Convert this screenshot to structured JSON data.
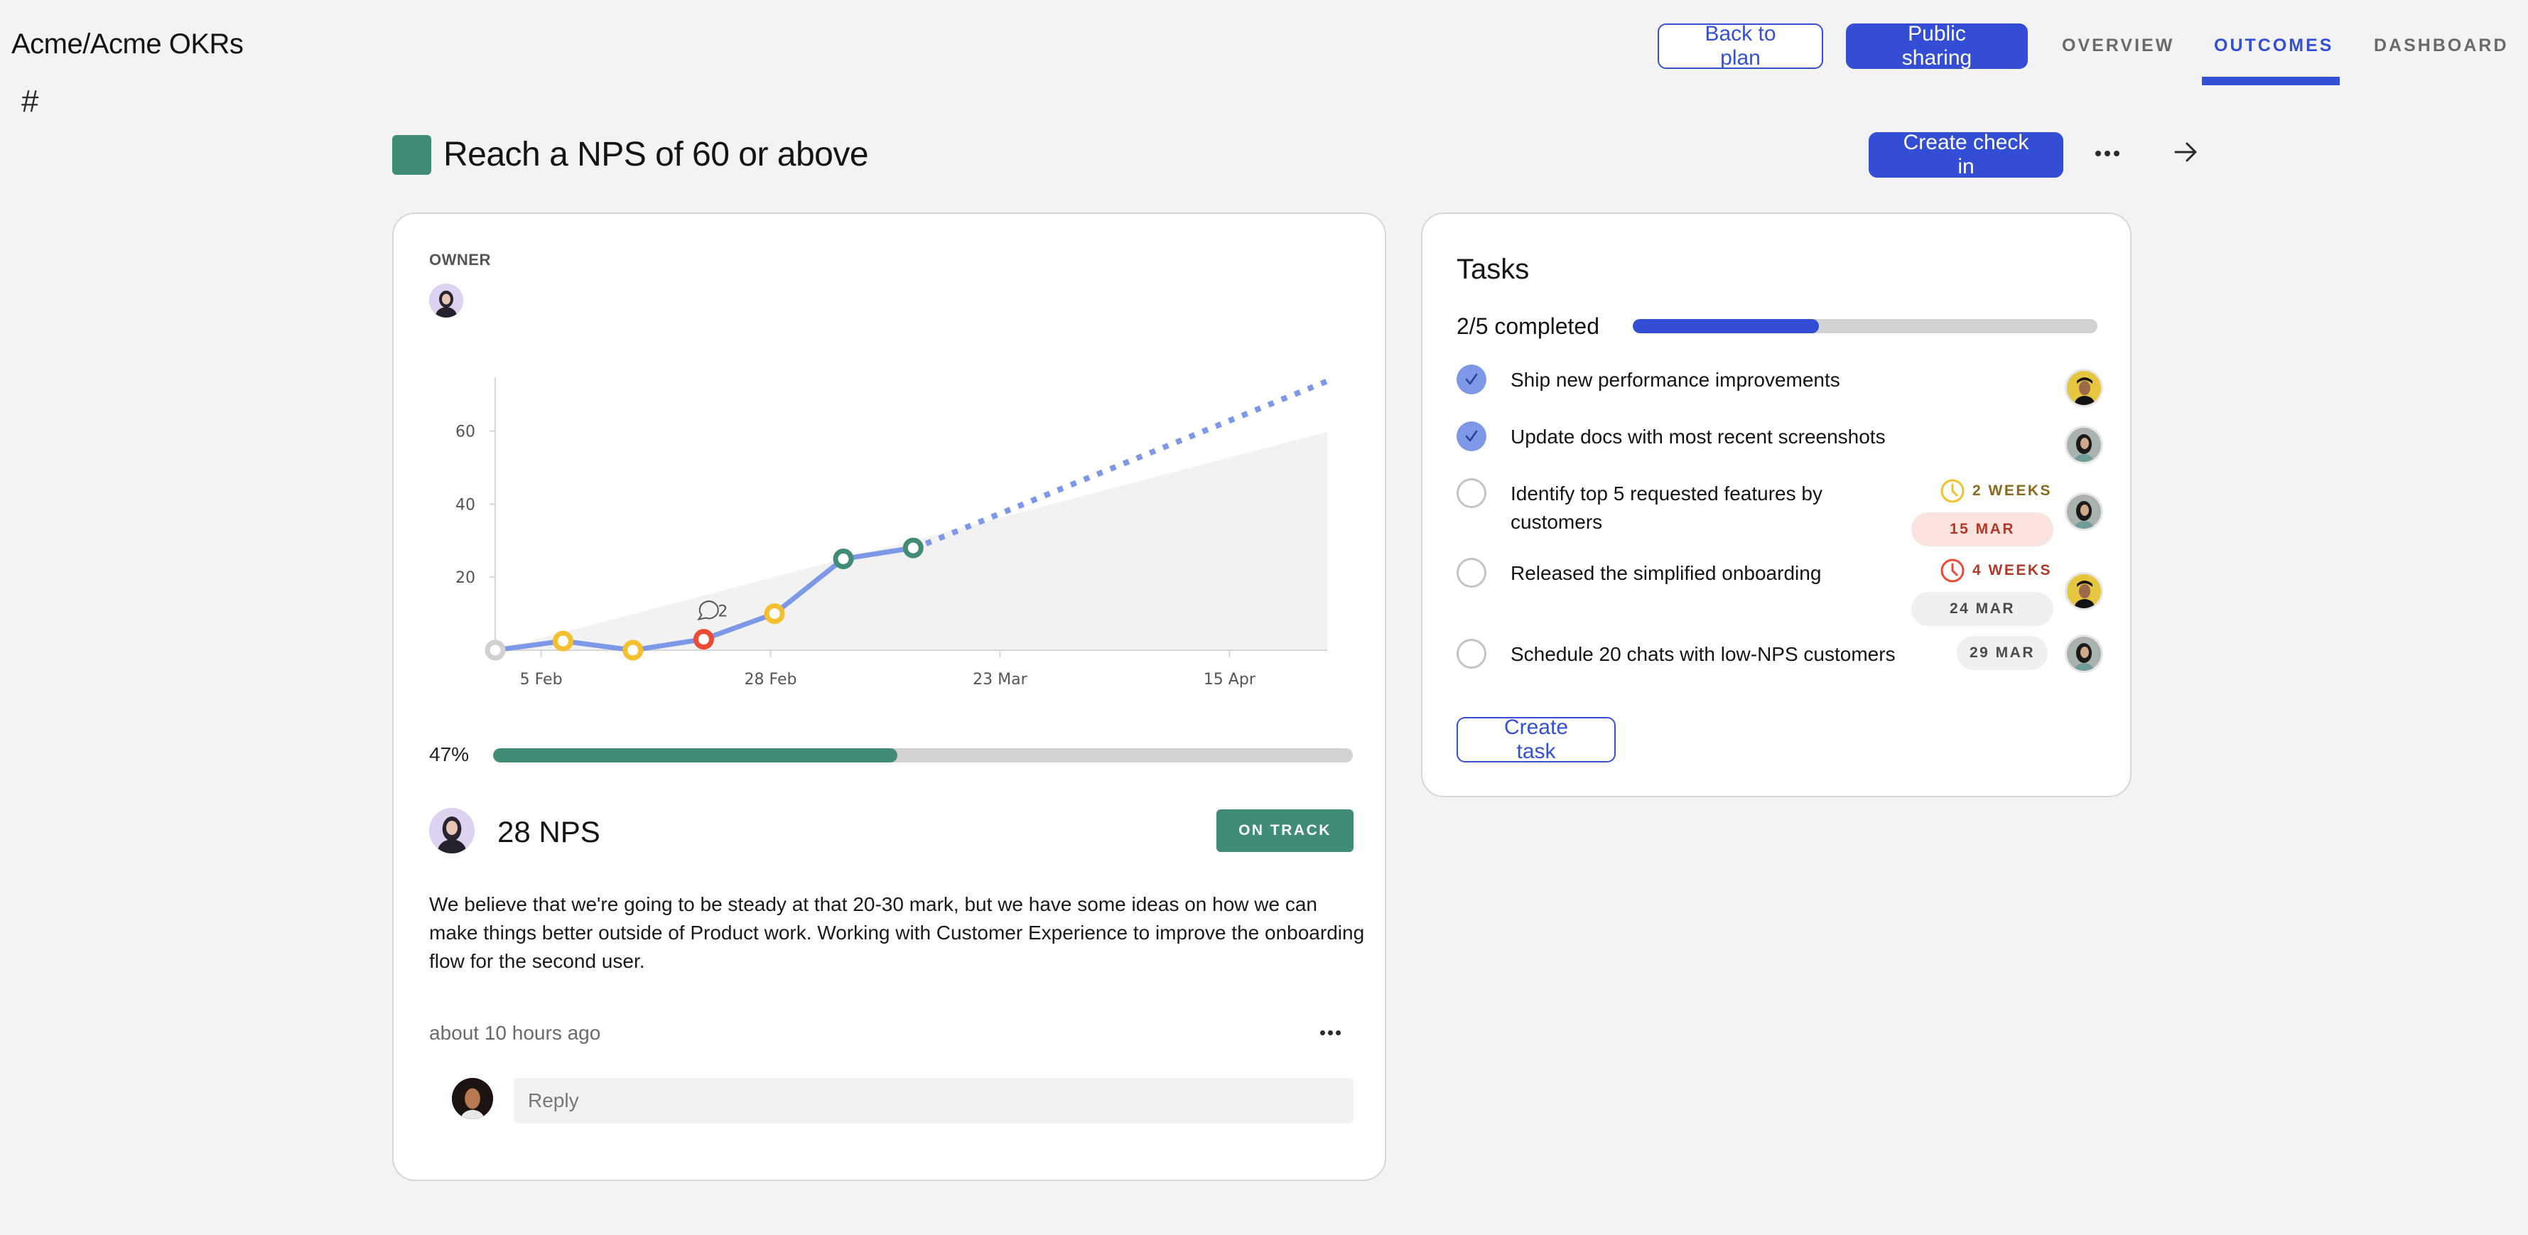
{
  "breadcrumb": {
    "workspace": "Acme",
    "separator": "/",
    "project": "Acme OKRs"
  },
  "sidebar": {
    "hash_icon": "#"
  },
  "header": {
    "back_button": "Back to plan",
    "share_button": "Public sharing",
    "tabs": [
      {
        "label": "OVERVIEW",
        "active": false
      },
      {
        "label": "OUTCOMES",
        "active": true
      },
      {
        "label": "DASHBOARD",
        "active": false
      }
    ]
  },
  "colors": {
    "accent": "#334ed4",
    "on_track": "#418c76",
    "at_risk": "#f5c02f",
    "off_track": "#ec4a34",
    "neutral": "#d0d0d0",
    "line": "#7d98e6",
    "target_area": "#f2f2f2"
  },
  "objective": {
    "title": "Reach a NPS of 60 or above",
    "color": "#418c76",
    "create_checkin_button": "Create check in",
    "more_icon": "more-horizontal-icon",
    "next_icon": "arrow-right-icon"
  },
  "outcome_card": {
    "owner_label": "OWNER",
    "progress_label": "47%",
    "progress_fraction": 0.47,
    "current_value": "28 NPS",
    "status": "ON TRACK",
    "comment": "We believe that we're going to be steady at that 20-30 mark, but we have some ideas on how we can make things better outside of Product work. Working with Customer Experience to improve the onboarding flow for the second user.",
    "timestamp": "about 10 hours ago",
    "reply_placeholder": "Reply"
  },
  "chart_data": {
    "type": "line",
    "title": "",
    "xlabel": "",
    "ylabel": "",
    "x_tick_labels": [
      "5 Feb",
      "28 Feb",
      "23 Mar",
      "15 Apr"
    ],
    "x_tick_days": [
      5,
      28,
      51,
      74
    ],
    "y_ticks": [
      20,
      40,
      60
    ],
    "ylim": [
      0,
      75
    ],
    "xlim_days": [
      0.4,
      37.1
    ],
    "grid": false,
    "series": [
      {
        "name": "Check-ins",
        "style": "solid",
        "points": [
          {
            "day": 0.4,
            "value": 0,
            "status": "neutral"
          },
          {
            "day": 7.2,
            "value": 2.5,
            "status": "at_risk"
          },
          {
            "day": 14.2,
            "value": 0,
            "status": "at_risk"
          },
          {
            "day": 21.3,
            "value": 3,
            "status": "off_track",
            "comments": 2
          },
          {
            "day": 28.4,
            "value": 10,
            "status": "at_risk"
          },
          {
            "day": 35.3,
            "value": 25,
            "status": "on_track"
          },
          {
            "day": 42.3,
            "value": 28,
            "status": "on_track"
          }
        ]
      },
      {
        "name": "Forecast",
        "style": "dotted",
        "points": [
          {
            "day": 42.3,
            "value": 28
          },
          {
            "day": 84.1,
            "value": 74
          }
        ]
      },
      {
        "name": "Target",
        "style": "area",
        "points": [
          {
            "day": 0.4,
            "value": 0
          },
          {
            "day": 35.3,
            "value": 25
          },
          {
            "day": 84.1,
            "value": 60
          }
        ]
      }
    ],
    "annotations": [
      {
        "day": 21.3,
        "label": "2",
        "icon": "comment-icon"
      }
    ]
  },
  "tasks": {
    "title": "Tasks",
    "completed_label": "2/5 completed",
    "completed_fraction": 0.4,
    "items": [
      {
        "label": "Ship new performance improvements",
        "done": true,
        "assignee": "yellow-cap"
      },
      {
        "label": "Update docs with most recent screenshots",
        "done": true,
        "assignee": "hijab"
      },
      {
        "label": "Identify top 5 requested features by customers",
        "done": false,
        "remaining": "2 WEEKS",
        "remaining_color": "#f5c02f",
        "remaining_text_color": "#8a6a1a",
        "due": "15 MAR",
        "overdue": true,
        "assignee": "hijab"
      },
      {
        "label": "Released the simplified onboarding",
        "done": false,
        "remaining": "4 WEEKS",
        "remaining_color": "#ec4a34",
        "remaining_text_color": "#b43828",
        "due": "24 MAR",
        "overdue": false,
        "assignee": "yellow-cap"
      },
      {
        "label": "Schedule 20 chats with low-NPS customers",
        "done": false,
        "due": "29 MAR",
        "overdue": false,
        "assignee": "hijab"
      }
    ],
    "create_button": "Create task"
  }
}
